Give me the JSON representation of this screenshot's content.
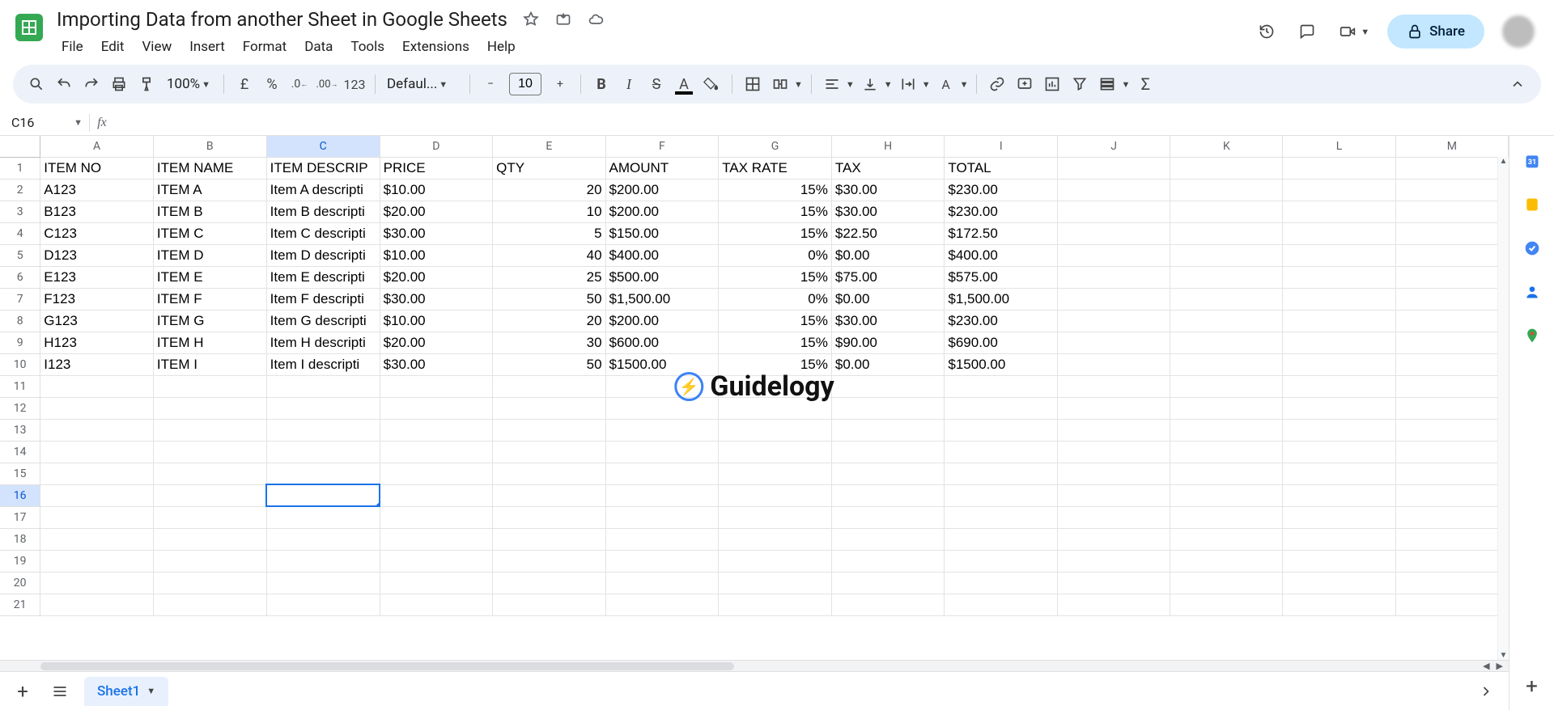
{
  "doc_title": "Importing Data from another Sheet in Google Sheets",
  "menu": [
    "File",
    "Edit",
    "View",
    "Insert",
    "Format",
    "Data",
    "Tools",
    "Extensions",
    "Help"
  ],
  "share_label": "Share",
  "toolbar": {
    "zoom": "100%",
    "currency": "£",
    "percent": "%",
    "dec_dec": ".0",
    "inc_dec": ".00",
    "numfmt": "123",
    "font": "Defaul...",
    "size": "10"
  },
  "namebox": "C16",
  "formula": "",
  "columns": [
    "A",
    "B",
    "C",
    "D",
    "E",
    "F",
    "G",
    "H",
    "I",
    "J",
    "K",
    "L",
    "M"
  ],
  "headers": [
    "ITEM NO",
    "ITEM NAME",
    "ITEM DESCRIPTION",
    "PRICE",
    "QTY",
    "AMOUNT",
    "TAX RATE",
    "TAX",
    "TOTAL"
  ],
  "rows": [
    {
      "a": "A123",
      "b": "ITEM A",
      "c": "Item A description",
      "d": "$10.00",
      "e": "20",
      "f": "$200.00",
      "g": "15%",
      "h": "$30.00",
      "i": "$230.00"
    },
    {
      "a": "B123",
      "b": "ITEM B",
      "c": "Item B description",
      "d": "$20.00",
      "e": "10",
      "f": "$200.00",
      "g": "15%",
      "h": "$30.00",
      "i": "$230.00"
    },
    {
      "a": "C123",
      "b": "ITEM C",
      "c": "Item C description",
      "d": "$30.00",
      "e": "5",
      "f": "$150.00",
      "g": "15%",
      "h": "$22.50",
      "i": "$172.50"
    },
    {
      "a": "D123",
      "b": "ITEM D",
      "c": "Item D description",
      "d": "$10.00",
      "e": "40",
      "f": "$400.00",
      "g": "0%",
      "h": "$0.00",
      "i": "$400.00"
    },
    {
      "a": "E123",
      "b": "ITEM E",
      "c": "Item E description",
      "d": "$20.00",
      "e": "25",
      "f": "$500.00",
      "g": "15%",
      "h": "$75.00",
      "i": "$575.00"
    },
    {
      "a": "F123",
      "b": "ITEM F",
      "c": "Item F description",
      "d": "$30.00",
      "e": "50",
      "f": "$1,500.00",
      "g": "0%",
      "h": "$0.00",
      "i": "$1,500.00"
    },
    {
      "a": "G123",
      "b": "ITEM G",
      "c": "Item G description",
      "d": "$10.00",
      "e": "20",
      "f": "$200.00",
      "g": "15%",
      "h": "$30.00",
      "i": "$230.00"
    },
    {
      "a": "H123",
      "b": "ITEM H",
      "c": "Item H description",
      "d": "$20.00",
      "e": "30",
      "f": "$600.00",
      "g": "15%",
      "h": "$90.00",
      "i": "$690.00"
    },
    {
      "a": "I123",
      "b": "ITEM I",
      "c": "Item I description",
      "d": "$30.00",
      "e": "50",
      "f": "$1500.00",
      "g": "15%",
      "h": "$0.00",
      "i": "$1500.00"
    }
  ],
  "total_display_rows": 21,
  "active_cell": {
    "col": "C",
    "row": 16
  },
  "sheet_tab": "Sheet1",
  "watermark": "Guidelogy"
}
